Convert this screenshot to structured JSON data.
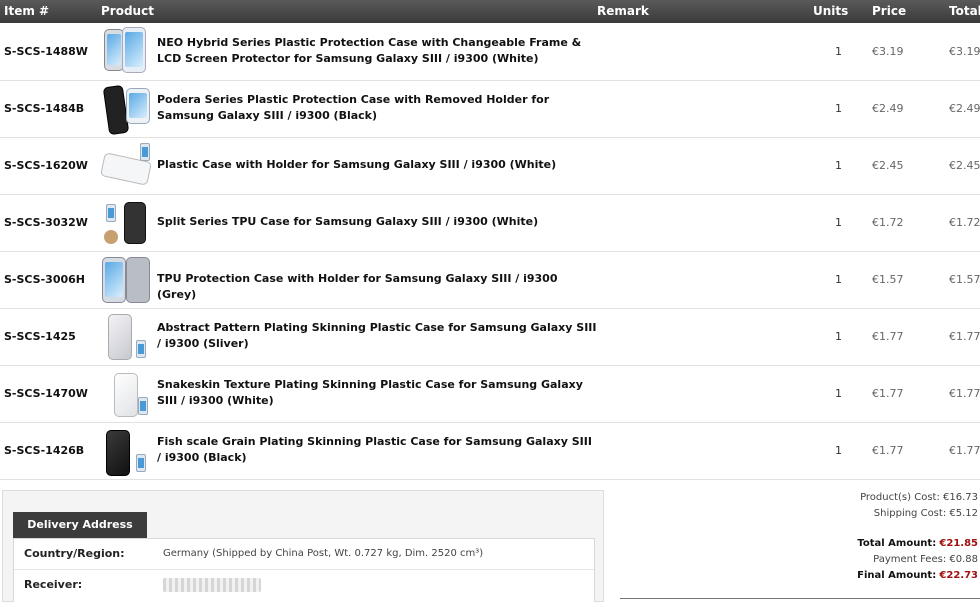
{
  "columns": {
    "item": "Item #",
    "product": "Product",
    "remark": "Remark",
    "units": "Units",
    "price": "Price",
    "total": "Total"
  },
  "rows": [
    {
      "sku": "S-SCS-1488W",
      "name": "NEO Hybrid Series Plastic Protection Case with Changeable Frame & LCD Screen Protector for Samsung Galaxy SIII / i9300 (White)",
      "units": "1",
      "price": "€3.19",
      "total": "€3.19"
    },
    {
      "sku": "S-SCS-1484B",
      "name": "Podera Series Plastic Protection Case with Removed Holder for Samsung Galaxy SIII / i9300 (Black)",
      "units": "1",
      "price": "€2.49",
      "total": "€2.49"
    },
    {
      "sku": "S-SCS-1620W",
      "name": "Plastic Case with Holder for Samsung Galaxy SIII / i9300 (White)",
      "units": "1",
      "price": "€2.45",
      "total": "€2.45"
    },
    {
      "sku": "S-SCS-3032W",
      "name": "Split Series TPU Case for Samsung Galaxy SIII / i9300 (White)",
      "units": "1",
      "price": "€1.72",
      "total": "€1.72"
    },
    {
      "sku": "S-SCS-3006H",
      "name": "TPU Protection Case with Holder for Samsung Galaxy SIII / i9300 (Grey)",
      "units": "1",
      "price": "€1.57",
      "total": "€1.57"
    },
    {
      "sku": "S-SCS-1425",
      "name": "Abstract Pattern Plating Skinning Plastic Case for Samsung Galaxy SIII / i9300 (Sliver)",
      "units": "1",
      "price": "€1.77",
      "total": "€1.77"
    },
    {
      "sku": "S-SCS-1470W",
      "name": "Snakeskin Texture Plating Skinning Plastic Case for Samsung Galaxy SIII / i9300 (White)",
      "units": "1",
      "price": "€1.77",
      "total": "€1.77"
    },
    {
      "sku": "S-SCS-1426B",
      "name": "Fish scale Grain Plating Skinning Plastic Case for Samsung Galaxy SIII / i9300 (Black)",
      "units": "1",
      "price": "€1.77",
      "total": "€1.77"
    }
  ],
  "delivery": {
    "tab_label": "Delivery Address",
    "country_label": "Country/Region:",
    "country_value": "Germany (Shipped by China Post, Wt. 0.727 kg, Dim. 2520 cm³)",
    "receiver_label": "Receiver:"
  },
  "summary": {
    "products_cost": "Product(s) Cost: €16.73",
    "shipping_cost": "Shipping Cost: €5.12",
    "total_amount_label": "Total Amount:",
    "total_amount_value": "€21.85",
    "payment_fees": "Payment Fees: €0.88",
    "final_amount_label": "Final Amount:",
    "final_amount_value": "€22.73"
  },
  "colors": {
    "header_bg": "#3a3a3a",
    "accent_red": "#a01010"
  }
}
